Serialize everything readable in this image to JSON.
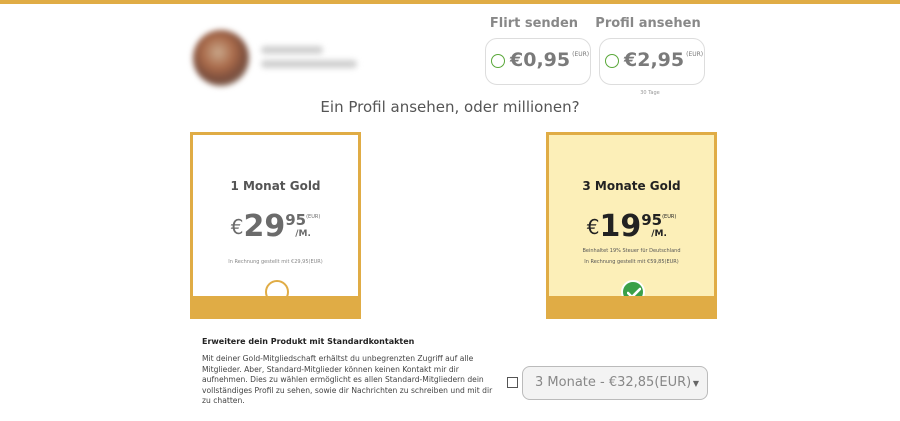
{
  "small_offers": [
    {
      "label": "Flirt senden",
      "price": "€0,95",
      "currency": "(EUR)"
    },
    {
      "label": "Profil ansehen",
      "price": "€2,95",
      "currency": "(EUR)",
      "note": "30 Tage"
    }
  ],
  "heading": "Ein Profil ansehen, oder millionen?",
  "plans": [
    {
      "title": "1 Monat Gold",
      "currency_symbol": "€",
      "price_int": "29",
      "price_dec": "95",
      "currency": "(EUR)",
      "per": "/M.",
      "note": "In Rechnung gestellt mit €29,95(EUR)",
      "selected": false
    },
    {
      "title": "3 Monate Gold",
      "currency_symbol": "€",
      "price_int": "19",
      "price_dec": "95",
      "currency": "(EUR)",
      "per": "/M.",
      "tax_note": "Beinhaltet 19% Steuer für Deutschland",
      "note": "In Rechnung gestellt mit €59,85(EUR)",
      "selected": true
    }
  ],
  "extension": {
    "title": "Erweitere dein Produkt mit Standardkontakten",
    "text": "Mit deiner Gold-Mitgliedschaft erhältst du unbegrenzten Zugriff auf alle Mitglieder. Aber, Standard-Mitglieder können keinen Kontakt mir dir aufnehmen. Dies zu wählen ermöglicht es allen Standard-Mitgliedern dein vollständiges Profil zu sehen, sowie dir Nachrichten zu schreiben und mit dir zu chatten.",
    "checked": false,
    "select_value": "3 Monate - €32,85(EUR)"
  },
  "colors": {
    "accent": "#e0ac45",
    "selected_bg": "#fcefb8",
    "check_green": "#3aa049"
  },
  "icons": {
    "selected": "check-circle-icon",
    "dropdown": "chevron-down-icon"
  }
}
